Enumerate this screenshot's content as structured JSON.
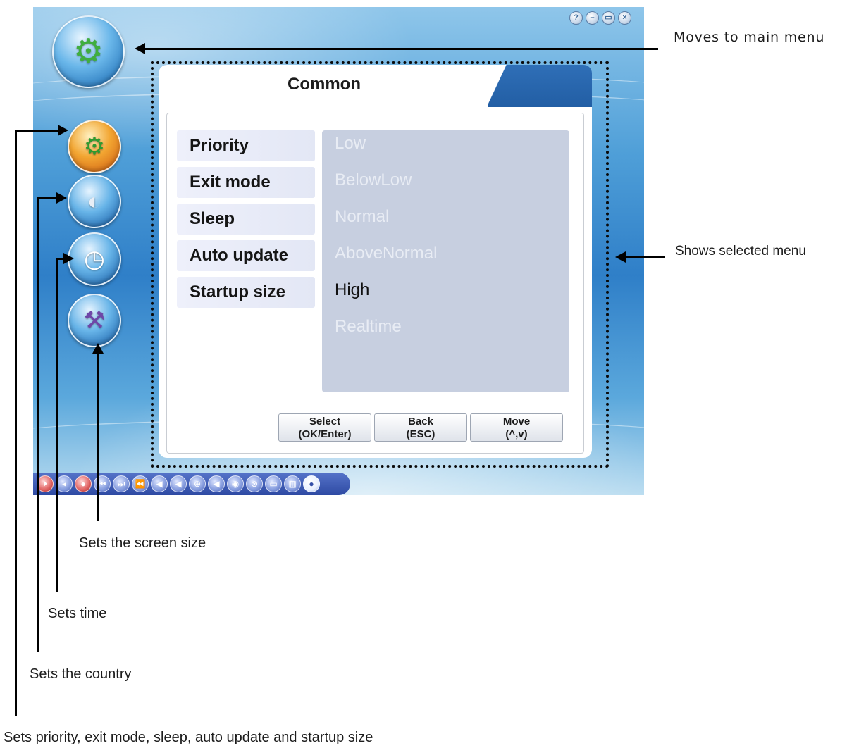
{
  "window": {
    "title_buttons": [
      "?",
      "–",
      "▭",
      "×"
    ]
  },
  "side_menu": {
    "main": {
      "icon": "tools-main-icon",
      "glyph": "⚙"
    },
    "items": [
      {
        "icon": "gear-icon",
        "glyph": "⚙"
      },
      {
        "icon": "globe-icon",
        "glyph": "◐"
      },
      {
        "icon": "clock-icon",
        "glyph": "◷"
      },
      {
        "icon": "hammer-icon",
        "glyph": "⚒"
      }
    ]
  },
  "panel": {
    "title": "Common",
    "options": [
      "Priority",
      "Exit mode",
      "Sleep",
      "Auto update",
      "Startup size"
    ],
    "values": [
      {
        "label": "Low",
        "active": false
      },
      {
        "label": "BelowLow",
        "active": false
      },
      {
        "label": "Normal",
        "active": false
      },
      {
        "label": "AboveNormal",
        "active": false
      },
      {
        "label": "High",
        "active": true
      },
      {
        "label": "Realtime",
        "active": false
      }
    ],
    "buttons": [
      {
        "line1": "Select",
        "line2": "(OK/Enter)"
      },
      {
        "line1": "Back",
        "line2": "(ESC)"
      },
      {
        "line1": "Move",
        "line2": "(^,v)"
      }
    ]
  },
  "taskbar": {
    "icons": [
      "⏵",
      "◂",
      "●",
      "⏮",
      "⏭",
      "⏪",
      "◀",
      "◀",
      "⊕",
      "◀",
      "◉",
      "⊗",
      "▭",
      "▥",
      "●"
    ]
  },
  "annotations": {
    "main_menu": "Moves to main menu",
    "shows_selected": "Shows selected menu",
    "screen_size": "Sets the screen size",
    "time": "Sets time",
    "country": "Sets the country",
    "priority": "Sets priority, exit mode, sleep, auto update and startup size"
  }
}
